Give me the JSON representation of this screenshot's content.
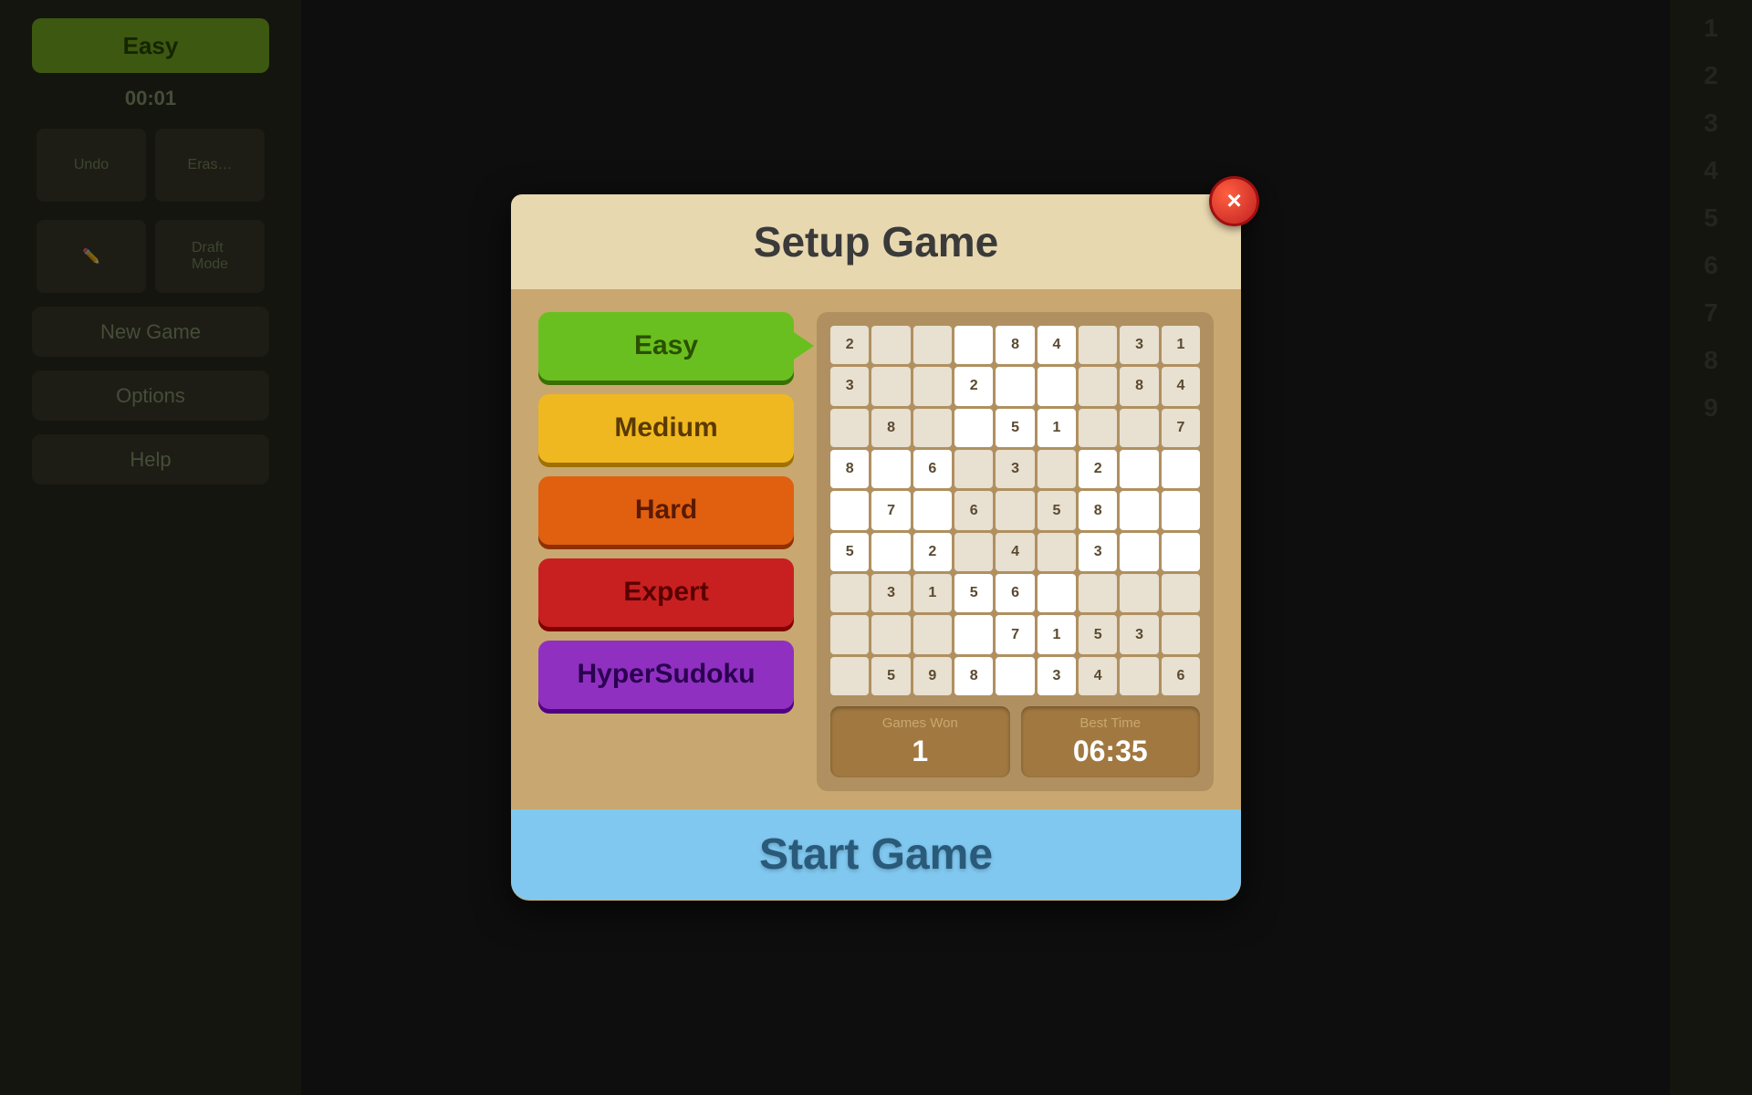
{
  "background": {
    "easy_label": "Easy",
    "timer": "00:01",
    "undo_label": "Undo",
    "erase_label": "Erase",
    "draft_mode_label": "Draft\nMode",
    "new_game_label": "New Game",
    "options_label": "Options",
    "help_label": "Help",
    "right_numbers": [
      "1",
      "2",
      "3",
      "4",
      "5",
      "6",
      "7",
      "8",
      "9"
    ]
  },
  "modal": {
    "title": "Setup Game",
    "close_icon": "×",
    "difficulty_buttons": [
      {
        "label": "Easy",
        "class": "easy"
      },
      {
        "label": "Medium",
        "class": "medium"
      },
      {
        "label": "Hard",
        "class": "hard"
      },
      {
        "label": "Expert",
        "class": "expert"
      },
      {
        "label": "HyperSudoku",
        "class": "hyper"
      }
    ],
    "sudoku_grid": [
      [
        "2",
        "",
        "",
        "",
        "8",
        "4",
        "",
        "3",
        "1"
      ],
      [
        "3",
        "",
        "",
        "2",
        "",
        "",
        "",
        "8",
        "4"
      ],
      [
        "",
        "8",
        "",
        "",
        "5",
        "1",
        "",
        "",
        "7"
      ],
      [
        "8",
        "",
        "6",
        "",
        "3",
        "",
        "2",
        "",
        ""
      ],
      [
        "",
        "7",
        "",
        "6",
        "",
        "5",
        "8",
        "",
        ""
      ],
      [
        "5",
        "",
        "2",
        "",
        "4",
        "",
        "3",
        "",
        ""
      ],
      [
        "",
        "3",
        "1",
        "5",
        "6",
        "",
        "",
        "",
        ""
      ],
      [
        "",
        "",
        "",
        "",
        "7",
        "1",
        "5",
        "3",
        ""
      ],
      [
        "",
        "5",
        "9",
        "8",
        "",
        "3",
        "4",
        "",
        "6"
      ]
    ],
    "stats": {
      "games_won_label": "Games Won",
      "games_won_value": "1",
      "best_time_label": "Best Time",
      "best_time_value": "06:35"
    },
    "start_button_label": "Start Game"
  }
}
